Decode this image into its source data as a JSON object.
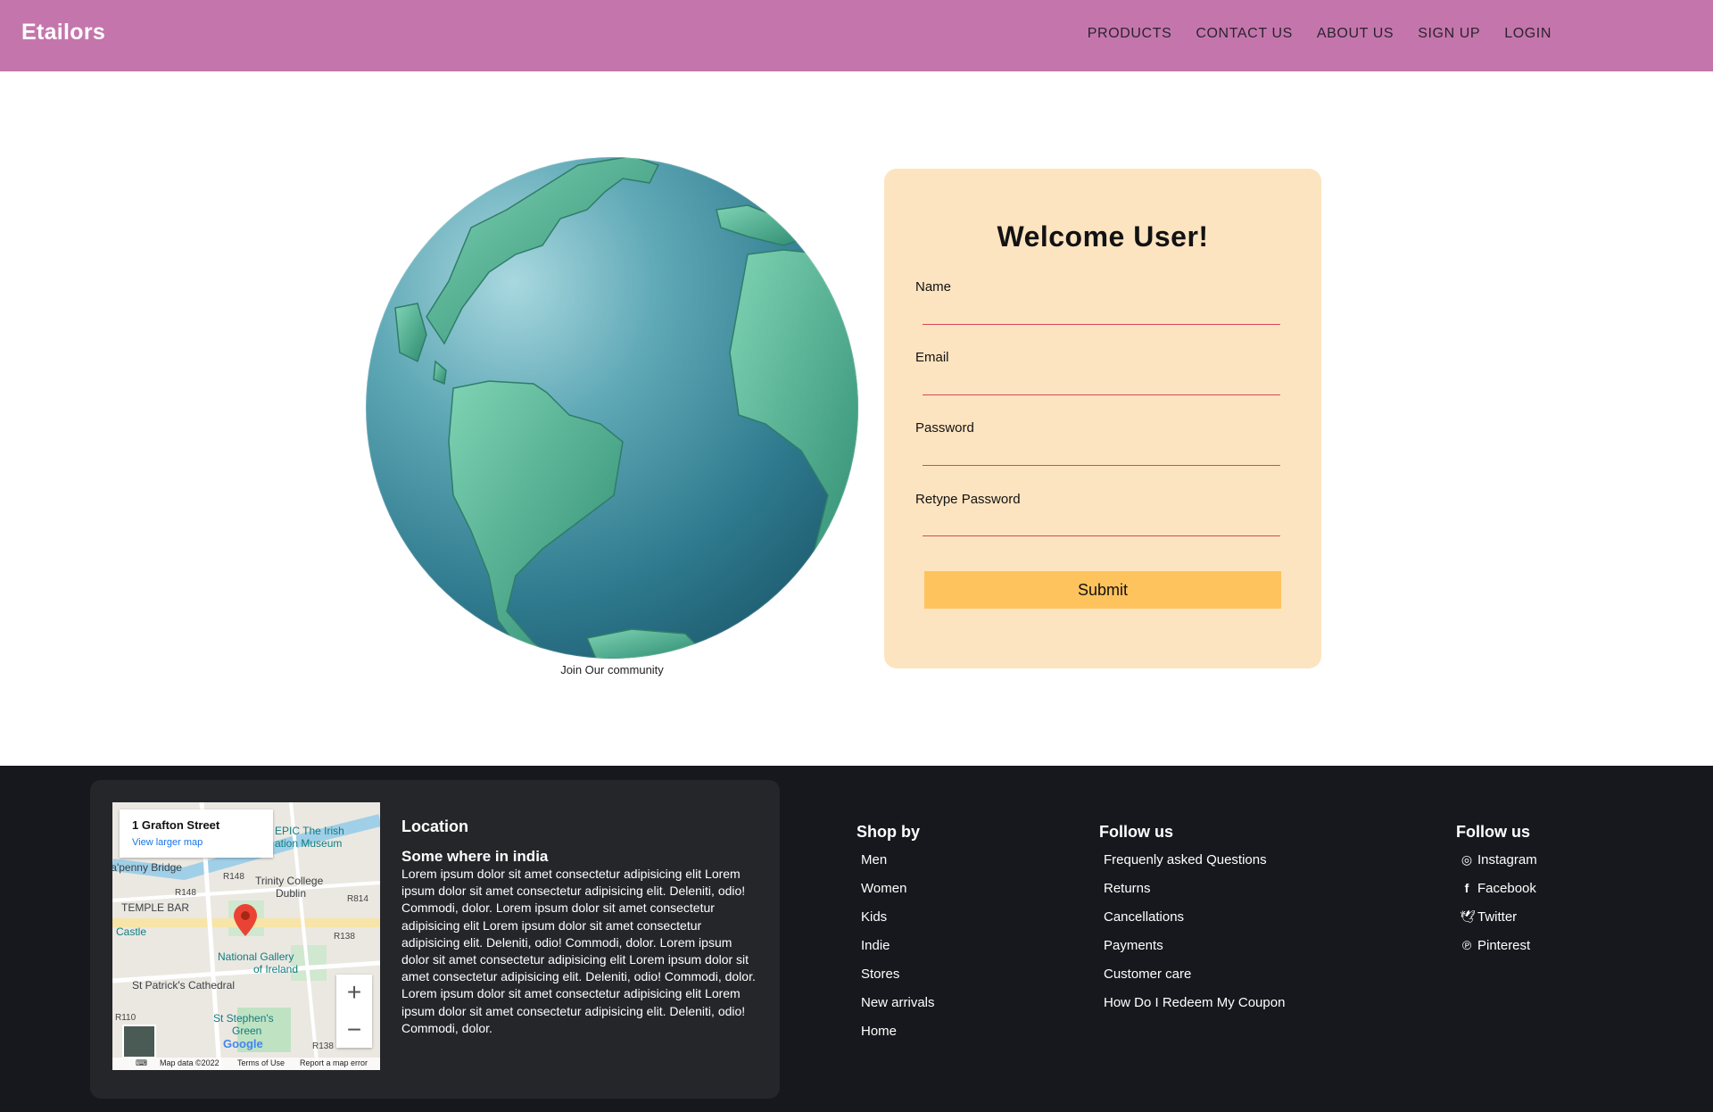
{
  "nav": {
    "brand": "Etailors",
    "links": [
      "PRODUCTS",
      "CONTACT US",
      "ABOUT US",
      "SIGN UP",
      "LOGIN"
    ]
  },
  "hero": {
    "caption": "Join Our community"
  },
  "form": {
    "title": "Welcome User!",
    "fields": [
      {
        "label": "Name",
        "value": ""
      },
      {
        "label": "Email",
        "value": ""
      },
      {
        "label": "Password",
        "value": ""
      },
      {
        "label": "Retype Password",
        "value": ""
      }
    ],
    "submit": "Submit"
  },
  "footer": {
    "map": {
      "address": "1 Grafton Street",
      "larger_map": "View larger map",
      "labels": [
        "EPIC The Irish",
        "ation Museum",
        "'a'penny Bridge",
        "Trinity College",
        "Dublin",
        "TEMPLE BAR",
        "Castle",
        "National Gallery",
        "of Ireland",
        "St Patrick's Cathedral",
        "St Stephen's",
        "Green"
      ],
      "road_labels": [
        "R148",
        "R148",
        "R814",
        "R138",
        "R110",
        "R138"
      ],
      "zoom_in": "+",
      "zoom_out": "−",
      "google": "Google",
      "map_data": "Map data ©2022",
      "terms": "Terms of Use",
      "report": "Report a map error"
    },
    "location": {
      "title": "Location",
      "subtitle": "Some where in india",
      "text": "Lorem ipsum dolor sit amet consectetur adipisicing elit Lorem ipsum dolor sit amet consectetur adipisicing elit. Deleniti, odio! Commodi, dolor. Lorem ipsum dolor sit amet consectetur adipisicing elit Lorem ipsum dolor sit amet consectetur adipisicing elit. Deleniti, odio! Commodi, dolor. Lorem ipsum dolor sit amet consectetur adipisicing elit Lorem ipsum dolor sit amet consectetur adipisicing elit. Deleniti, odio! Commodi, dolor. Lorem ipsum dolor sit amet consectetur adipisicing elit Lorem ipsum dolor sit amet consectetur adipisicing elit. Deleniti, odio! Commodi, dolor."
    },
    "shop_by": {
      "title": "Shop by",
      "items": [
        "Men",
        "Women",
        "Kids",
        "Indie",
        "Stores",
        "New arrivals",
        "Home"
      ]
    },
    "help": {
      "title": "Follow us",
      "items": [
        "Frequenly asked Questions",
        "Returns",
        "Cancellations",
        "Payments",
        "Customer care",
        "How Do I Redeem My Coupon"
      ]
    },
    "social": {
      "title": "Follow us",
      "items": [
        {
          "icon": "instagram-icon",
          "label": "Instagram"
        },
        {
          "icon": "facebook-icon",
          "label": "Facebook"
        },
        {
          "icon": "twitter-icon",
          "label": "Twitter"
        },
        {
          "icon": "pinterest-icon",
          "label": "Pinterest"
        }
      ]
    }
  },
  "colors": {
    "navbar": "#c476ac",
    "form_bg": "#fde4c0",
    "submit_bg": "#ffc35d",
    "input_underline": "#d8475e",
    "footer_bg": "#16181d",
    "card_bg": "#25262a"
  }
}
